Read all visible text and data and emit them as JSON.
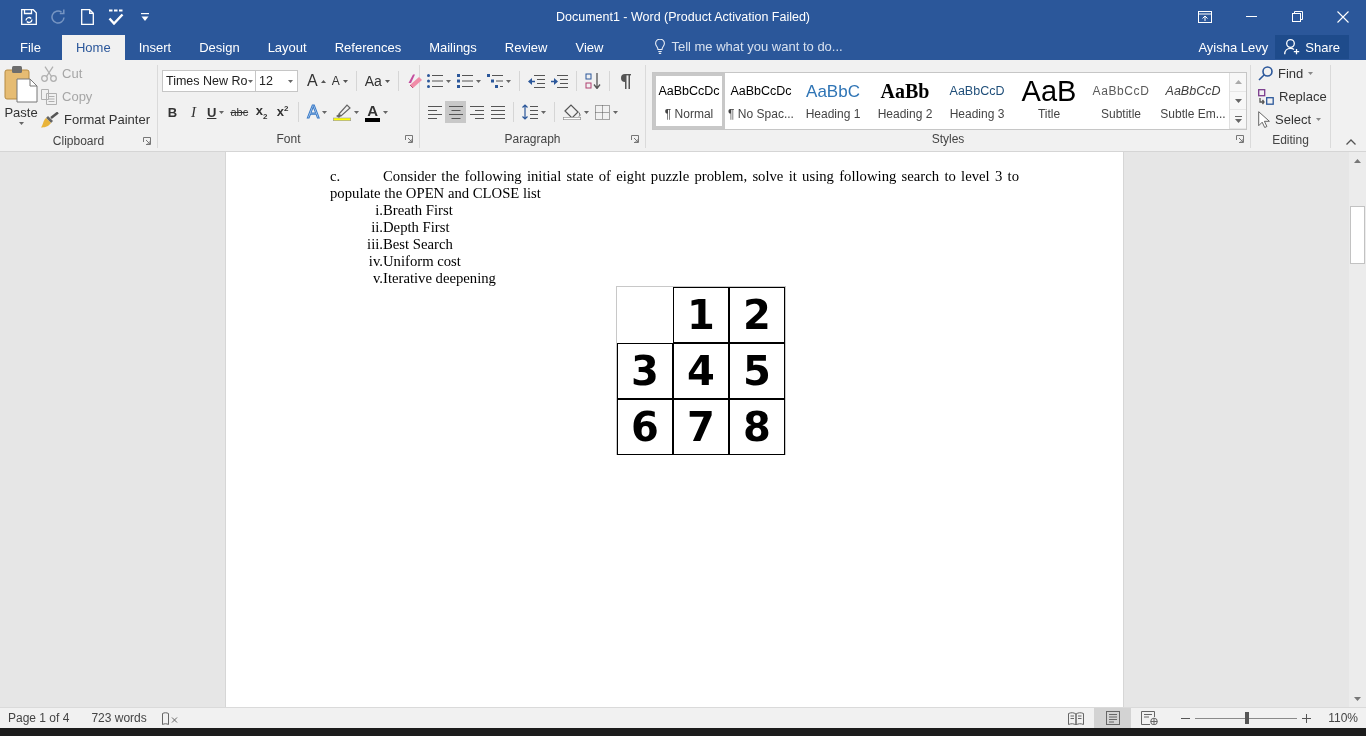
{
  "window": {
    "title": "Document1 - Word (Product Activation Failed)"
  },
  "quick_access": [
    {
      "kind": "save",
      "disabled": false
    },
    {
      "kind": "redo",
      "disabled": true
    },
    {
      "kind": "new",
      "disabled": false
    },
    {
      "kind": "spelling",
      "disabled": false
    },
    {
      "kind": "customize",
      "disabled": false
    }
  ],
  "tabs": [
    {
      "label": "File",
      "selected": false
    },
    {
      "label": "Home",
      "selected": true
    },
    {
      "label": "Insert",
      "selected": false
    },
    {
      "label": "Design",
      "selected": false
    },
    {
      "label": "Layout",
      "selected": false
    },
    {
      "label": "References",
      "selected": false
    },
    {
      "label": "Mailings",
      "selected": false
    },
    {
      "label": "Review",
      "selected": false
    },
    {
      "label": "View",
      "selected": false
    }
  ],
  "tell_me": {
    "placeholder": "Tell me what you want to do..."
  },
  "account": {
    "user": "Ayisha Levy",
    "share": "Share"
  },
  "ribbon": {
    "clipboard": {
      "title": "Clipboard",
      "paste": "Paste",
      "items": [
        {
          "kind": "cut",
          "label": "Cut",
          "disabled": true
        },
        {
          "kind": "copy",
          "label": "Copy",
          "disabled": true
        },
        {
          "kind": "painter",
          "label": "Format Painter",
          "disabled": false
        }
      ]
    },
    "font": {
      "title": "Font",
      "family": "Times New Ro",
      "size": "12",
      "tools": [
        {
          "kind": "grow",
          "label": "A"
        },
        {
          "kind": "shrink",
          "label": "A"
        },
        {
          "kind": "case",
          "label": "Aa"
        }
      ],
      "formats": [
        {
          "kind": "bold",
          "label": "B"
        },
        {
          "kind": "italic",
          "label": "I"
        },
        {
          "kind": "underline",
          "label": "U"
        },
        {
          "kind": "strike",
          "label": "abc"
        },
        {
          "kind": "subscript",
          "label": "x$_{2}$"
        },
        {
          "kind": "superscript",
          "label": "x$^{2}$"
        }
      ],
      "effects": [
        {
          "kind": "effects",
          "label": "A"
        },
        {
          "kind": "highlight"
        },
        {
          "kind": "color",
          "label": "A"
        }
      ]
    },
    "paragraph": {
      "title": "Paragraph",
      "alignment": [
        {
          "kind": "left",
          "selected": false
        },
        {
          "kind": "center",
          "selected": true
        },
        {
          "kind": "right",
          "selected": false
        },
        {
          "kind": "justify",
          "selected": false
        }
      ]
    },
    "styles": {
      "title": "Styles",
      "items": [
        {
          "kind": "normal",
          "preview": "AaBbCcDc",
          "name": "¶ Normal",
          "selected": true
        },
        {
          "kind": "normal",
          "preview": "AaBbCcDc",
          "name": "¶ No Spac...",
          "selected": false
        },
        {
          "kind": "heading1",
          "preview": "AaBbC",
          "name": "Heading 1",
          "selected": false
        },
        {
          "kind": "heading2",
          "preview": "AaBb",
          "name": "Heading 2",
          "selected": false
        },
        {
          "kind": "heading3",
          "preview": "AaBbCcD",
          "name": "Heading 3",
          "selected": false
        },
        {
          "kind": "title",
          "preview": "AaB",
          "name": "Title",
          "selected": false
        },
        {
          "kind": "subtitle",
          "preview": "AaBbCcD",
          "name": "Subtitle",
          "selected": false
        },
        {
          "kind": "subtle",
          "preview": "AaBbCcD",
          "name": "Subtle Em...",
          "selected": false
        }
      ]
    },
    "editing": {
      "title": "Editing",
      "items": [
        {
          "kind": "find",
          "label": "Find"
        },
        {
          "kind": "replace",
          "label": "Replace"
        },
        {
          "kind": "select",
          "label": "Select"
        }
      ]
    }
  },
  "document": {
    "paragraph": {
      "marker": "c.",
      "text": "Consider the following initial state of eight puzzle problem, solve it using following search to level 3 to populate the OPEN and CLOSE list"
    },
    "list": [
      {
        "number": "i.",
        "text": "Breath First"
      },
      {
        "number": "ii.",
        "text": "Depth First"
      },
      {
        "number": "iii.",
        "text": "Best Search"
      },
      {
        "number": "iv.",
        "text": "Uniform cost"
      },
      {
        "number": "v.",
        "text": "Iterative deepening"
      }
    ],
    "puzzle": {
      "tiles": [
        {
          "kind": "blank"
        },
        {
          "kind": "number",
          "label": "1"
        },
        {
          "kind": "number",
          "label": "2"
        },
        {
          "kind": "number",
          "label": "3"
        },
        {
          "kind": "number",
          "label": "4"
        },
        {
          "kind": "number",
          "label": "5"
        },
        {
          "kind": "number",
          "label": "6"
        },
        {
          "kind": "number",
          "label": "7"
        },
        {
          "kind": "number",
          "label": "8"
        }
      ]
    }
  },
  "status_bar": {
    "page": "Page 1 of 4",
    "words": "723 words",
    "views": [
      {
        "kind": "read",
        "selected": false
      },
      {
        "kind": "print",
        "selected": true
      },
      {
        "kind": "web",
        "selected": false
      }
    ],
    "zoom": {
      "level": 0.51,
      "label": "110%"
    }
  }
}
